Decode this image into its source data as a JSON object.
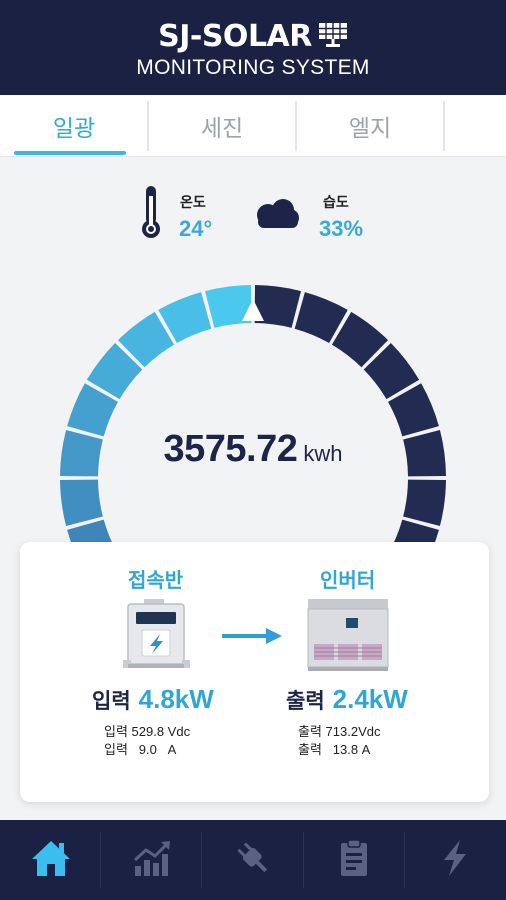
{
  "header": {
    "brand": "SJ-SOLAR",
    "subtitle": "MONITORING SYSTEM",
    "logo_icon": "solar-panel-icon"
  },
  "tabs": [
    {
      "label": "일광",
      "active": true
    },
    {
      "label": "세진",
      "active": false
    },
    {
      "label": "엘지",
      "active": false
    }
  ],
  "weather": {
    "temperature": {
      "label": "온도",
      "value": "24°",
      "icon": "thermometer-icon"
    },
    "humidity": {
      "label": "습도",
      "value": "33%",
      "icon": "cloud-icon"
    }
  },
  "gauge": {
    "value": "3575.72",
    "unit": "kwh",
    "fill_fraction": 0.5,
    "colors": {
      "filled_start": "#4ac8ee",
      "filled_end": "#3a5e9a",
      "empty": "#222b52",
      "marker": "#ffffff"
    }
  },
  "card": {
    "junction": {
      "title": "접속반",
      "icon": "junction-box-icon",
      "main_label": "입력",
      "main_value": "4.8kW",
      "detail_1": "입력 529.8 Vdc",
      "detail_2": "입력   9.0   A"
    },
    "arrow_icon": "arrow-right-icon",
    "inverter": {
      "title": "인버터",
      "icon": "inverter-icon",
      "main_label": "출력",
      "main_value": "2.4kW",
      "detail_1": "출력 713.2Vdc",
      "detail_2": "출력   13.8 A"
    }
  },
  "bottom_nav": [
    {
      "icon": "home-icon",
      "active": true
    },
    {
      "icon": "chart-icon",
      "active": false
    },
    {
      "icon": "plug-icon",
      "active": false
    },
    {
      "icon": "clipboard-icon",
      "active": false
    },
    {
      "icon": "lightning-icon",
      "active": false
    }
  ],
  "colors": {
    "navy": "#1b2142",
    "accent": "#2fa6d6",
    "inactive_icon": "#5a6183"
  }
}
